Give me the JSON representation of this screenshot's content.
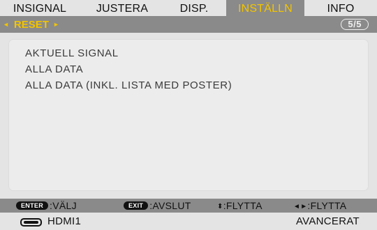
{
  "tabs": [
    {
      "label": "INSIGNAL",
      "active": false
    },
    {
      "label": "JUSTERA",
      "active": false
    },
    {
      "label": "DISP.",
      "active": false
    },
    {
      "label": "INSTÄLLN",
      "active": true
    },
    {
      "label": "INFO",
      "active": false
    }
  ],
  "subheader": {
    "title": "RESET",
    "left_arrow": "◄",
    "right_arrow": "►",
    "page": "5/5"
  },
  "menu": {
    "items": [
      "AKTUELL SIGNAL",
      "ALLA DATA",
      "ALLA DATA (INKL. LISTA MED POSTER)"
    ]
  },
  "help": {
    "enter_key": "ENTER",
    "enter_label": ":VÄLJ",
    "exit_key": "EXIT",
    "exit_label": ":AVSLUT",
    "updown_glyph": "⬍",
    "updown_label": ":FLYTTA",
    "leftright_glyph": "◄►",
    "leftright_label": ":FLYTTA"
  },
  "status": {
    "input_icon": "hdmi-port-icon",
    "input": "HDMI1",
    "mode": "AVANCERAT"
  },
  "colors": {
    "accent": "#f2c400",
    "bar": "#8a8a8a",
    "background": "#e4e4e4"
  }
}
